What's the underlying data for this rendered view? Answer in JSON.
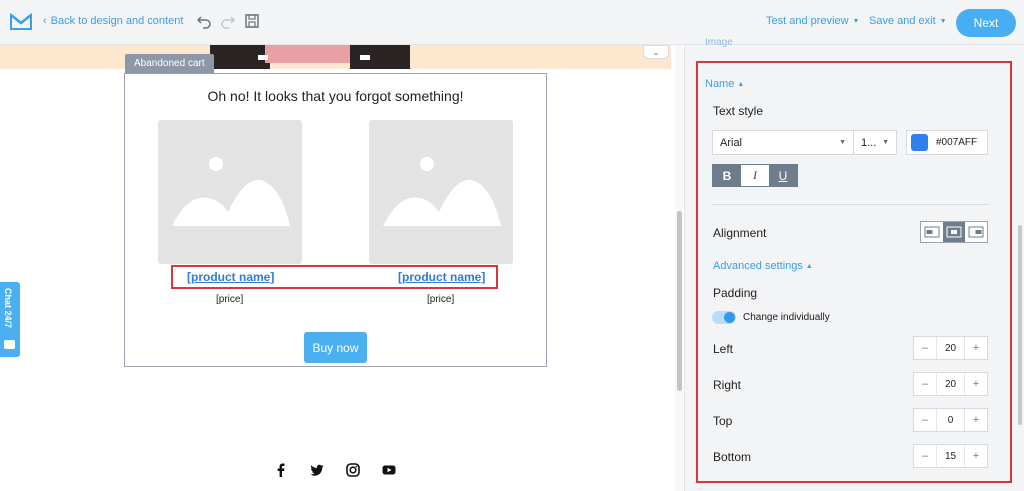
{
  "topbar": {
    "back_label": "Back to design and content",
    "test_preview_label": "Test and preview",
    "save_exit_label": "Save and exit",
    "next_label": "Next"
  },
  "canvas": {
    "block_tag": "Abandoned cart",
    "email_title": "Oh no! It looks that you forgot something!",
    "products": [
      {
        "name": "[product name]",
        "price": "[price]"
      },
      {
        "name": "[product name]",
        "price": "[price]"
      }
    ],
    "buy_label": "Buy now",
    "chat_label": "Chat 24/7",
    "social_icons": [
      "facebook-icon",
      "twitter-icon",
      "instagram-icon",
      "youtube-icon"
    ]
  },
  "panel": {
    "top_label": "Image",
    "section_name": "Name",
    "text_style_label": "Text style",
    "font_family": "Arial",
    "font_size": "1...",
    "color_hex": "#007AFF",
    "format_buttons": {
      "bold": "B",
      "italic": "I",
      "underline": "U"
    },
    "alignment_label": "Alignment",
    "advanced_label": "Advanced settings",
    "padding_label": "Padding",
    "change_individually_label": "Change individually",
    "padding": [
      {
        "label": "Left",
        "value": "20"
      },
      {
        "label": "Right",
        "value": "20"
      },
      {
        "label": "Top",
        "value": "0"
      },
      {
        "label": "Bottom",
        "value": "15"
      }
    ]
  },
  "colors": {
    "accent": "#4ab0f0",
    "link": "#3a9fe8",
    "highlight": "#d9363e",
    "swatch": "#2f7ff0"
  }
}
